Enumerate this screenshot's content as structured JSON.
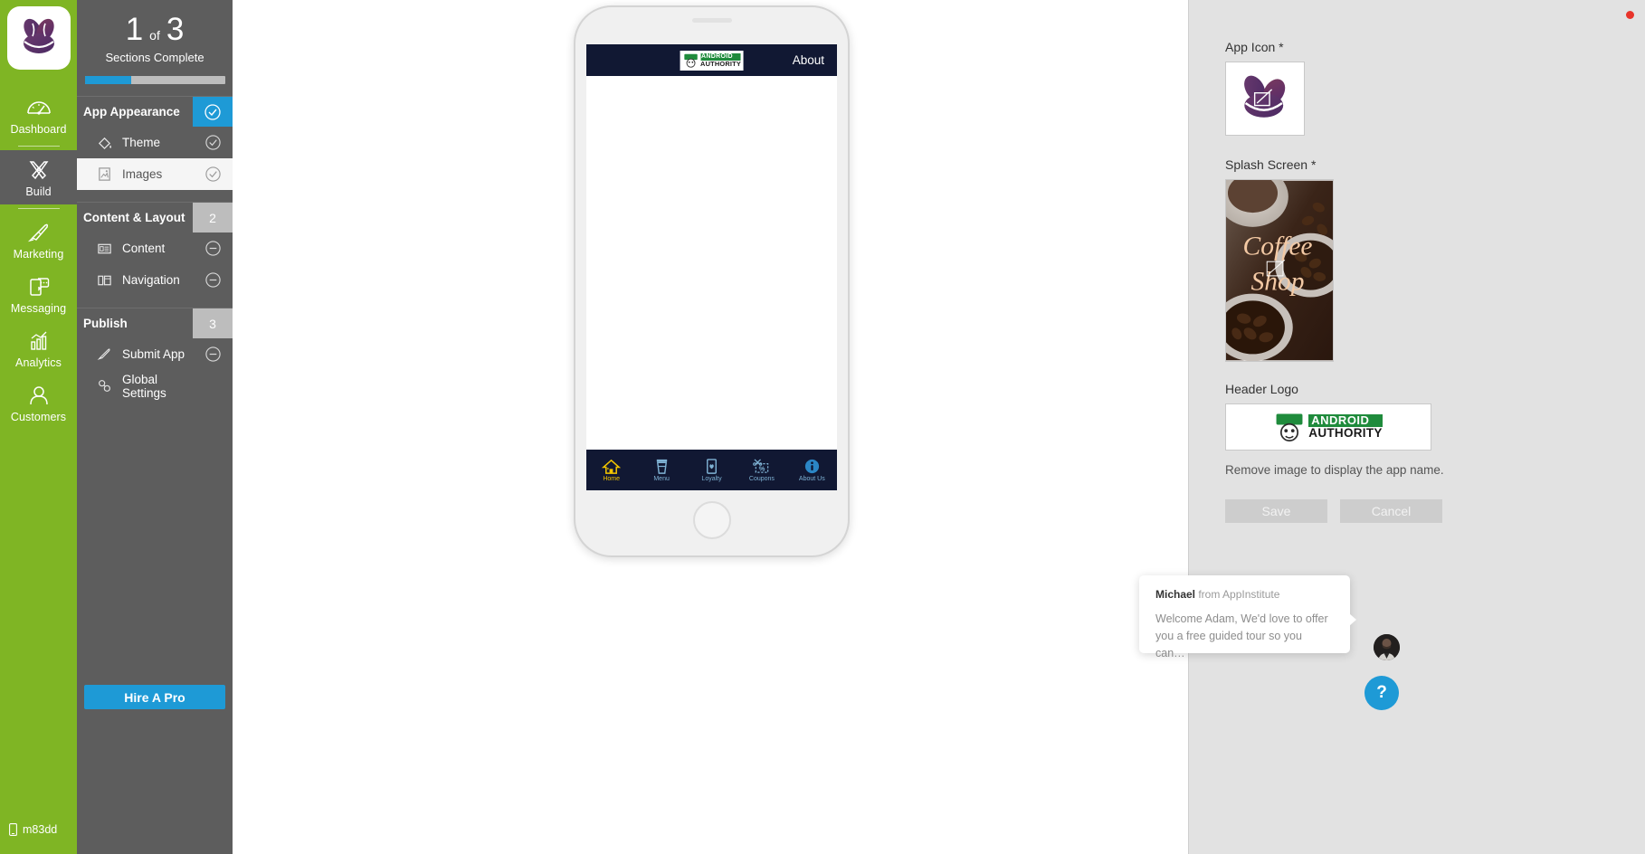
{
  "rail": {
    "logo_icon": "coffee-beans-logo",
    "items": [
      {
        "label": "Dashboard",
        "icon": "dashboard-gauge-icon",
        "active": false
      },
      {
        "label": "Build",
        "icon": "build-tools-icon",
        "active": true
      },
      {
        "label": "Marketing",
        "icon": "rocket-icon",
        "active": false
      },
      {
        "label": "Messaging",
        "icon": "chat-phone-icon",
        "active": false
      },
      {
        "label": "Analytics",
        "icon": "bar-chart-icon",
        "active": false
      },
      {
        "label": "Customers",
        "icon": "user-icon",
        "active": false
      }
    ],
    "app_id": "m83dd",
    "app_id_icon": "mobile-phone-icon"
  },
  "sidebar": {
    "progress": {
      "completed": "1",
      "of": "of",
      "total": "3",
      "caption": "Sections Complete",
      "percent": 33
    },
    "sections": [
      {
        "title": "App Appearance",
        "badge": "check",
        "badge_style": "blue",
        "items": [
          {
            "label": "Theme",
            "icon": "paint-bucket-icon",
            "state": "check",
            "selected": false
          },
          {
            "label": "Images",
            "icon": "image-icon",
            "state": "check",
            "selected": true
          }
        ]
      },
      {
        "title": "Content & Layout",
        "badge": "2",
        "badge_style": "grey",
        "items": [
          {
            "label": "Content",
            "icon": "content-list-icon",
            "state": "minus",
            "selected": false
          },
          {
            "label": "Navigation",
            "icon": "navigation-layout-icon",
            "state": "minus",
            "selected": false
          }
        ]
      },
      {
        "title": "Publish",
        "badge": "3",
        "badge_style": "grey",
        "items": [
          {
            "label": "Submit App",
            "icon": "rocket-icon",
            "state": "minus",
            "selected": false
          },
          {
            "label": "Global Settings",
            "icon": "settings-link-icon",
            "state": "none",
            "selected": false
          }
        ]
      }
    ],
    "hire_a_pro_label": "Hire A Pro"
  },
  "preview": {
    "header": {
      "logo_alt": "ANDROID AUTHORITY",
      "logo_line1": "ANDROID",
      "logo_line2": "AUTHORITY",
      "title": "About"
    },
    "nav": [
      {
        "label": "Home",
        "icon": "home-icon",
        "active": true
      },
      {
        "label": "Menu",
        "icon": "coffee-cup-icon",
        "active": false
      },
      {
        "label": "Loyalty",
        "icon": "loyalty-card-heart-icon",
        "active": false
      },
      {
        "label": "Coupons",
        "icon": "coupon-scissors-percent-icon",
        "active": false
      },
      {
        "label": "About Us",
        "icon": "info-icon",
        "active": false
      }
    ]
  },
  "right_panel": {
    "app_icon_label": "App Icon *",
    "splash_label": "Splash Screen *",
    "splash_text_line1": "Coffee",
    "splash_text_line2": "Shop",
    "header_logo_label": "Header Logo",
    "header_logo_line1": "ANDROID",
    "header_logo_line2": "AUTHORITY",
    "hint": "Remove image to display the app name.",
    "save_label": "Save",
    "cancel_label": "Cancel"
  },
  "chat": {
    "sender_name": "Michael",
    "sender_org": " from AppInstitute",
    "message": "Welcome Adam, We'd love to offer you a free guided tour so you can…",
    "help_glyph": "?"
  },
  "colors": {
    "rail_green": "#7fb524",
    "sidebar_grey": "#5d5d5d",
    "accent_blue": "#1e9ad6",
    "panel_grey": "#e2e2e2",
    "app_navy": "#111833",
    "nav_active_yellow": "#f2c500",
    "nav_inactive_blue": "#7fb2d4",
    "record_red": "#e8342a"
  }
}
